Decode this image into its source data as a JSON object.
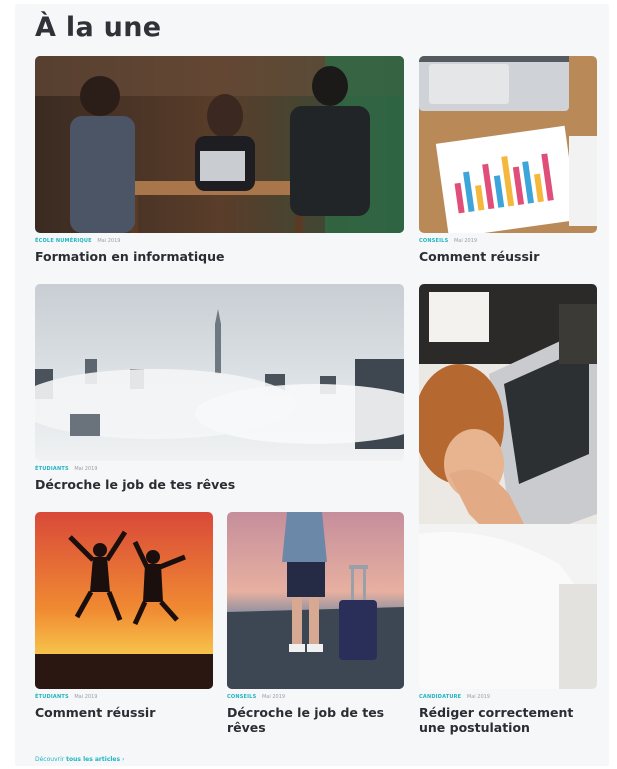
{
  "section_title": "À la une",
  "articles": [
    {
      "category": "ÉCOLE NUMÉRIQUE",
      "date": "Mai 2019",
      "title": "Formation en informatique"
    },
    {
      "category": "CONSEILS",
      "date": "Mai 2019",
      "title": "Comment réussir"
    },
    {
      "category": "ÉTUDIANTS",
      "date": "Mai 2019",
      "title": "Décroche le job de tes rêves"
    },
    {
      "category": "ÉTUDIANTS",
      "date": "Mai 2019",
      "title": "Comment réussir"
    },
    {
      "category": "CONSEILS",
      "date": "Mai 2019",
      "title": "Décroche le job de tes rêves"
    },
    {
      "category": "CANDIDATURE",
      "date": "Mai 2019",
      "title": "Rédiger correctement une postulation"
    }
  ],
  "footer_link": {
    "prefix": "Découvrir",
    "rest": "tous les articles",
    "arrow": "›"
  },
  "colors": {
    "accent": "#1fb5c2",
    "title": "#2a2d33",
    "background": "#f6f7f9"
  },
  "images": [
    "group-working-cafe-photo",
    "analytics-report-desk-photo",
    "city-above-clouds-photo",
    "people-jumping-sunset-photo",
    "traveler-with-suitcase-photo",
    "stressed-person-laptop-photo"
  ]
}
